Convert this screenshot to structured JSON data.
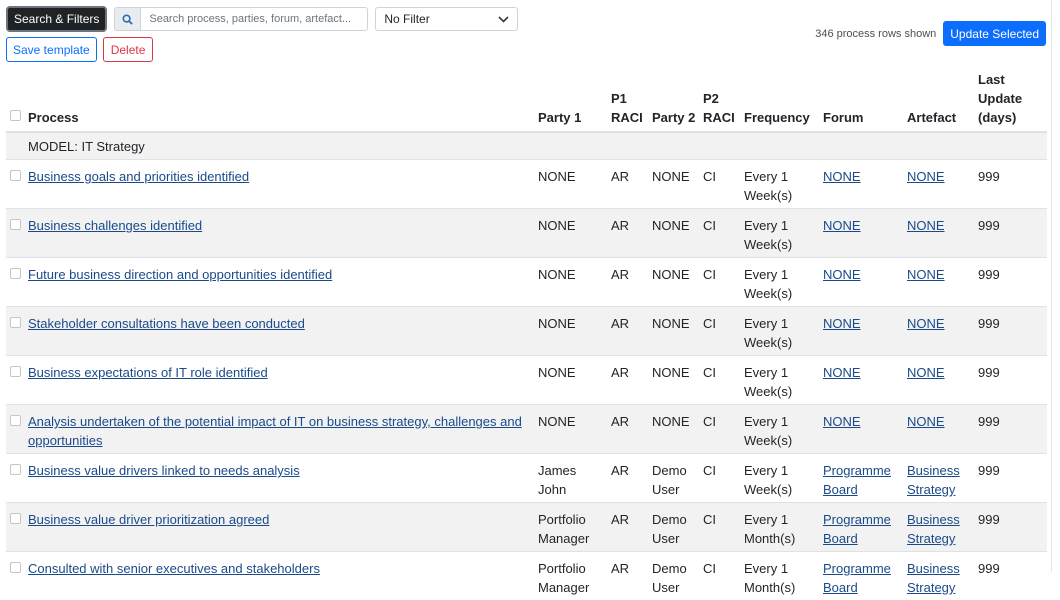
{
  "toolbar": {
    "search_filters_label": "Search & Filters",
    "search_placeholder": "Search process, parties, forum, artefact...",
    "filter_value": "No Filter",
    "save_template_label": "Save template",
    "delete_label": "Delete",
    "rows_shown": "346 process rows shown",
    "update_selected_label": "Update Selected"
  },
  "table": {
    "headers": {
      "process": "Process",
      "party1": "Party 1",
      "p1raci_a": "P1",
      "p1raci_b": "RACI",
      "party2": "Party 2",
      "p2raci_a": "P2",
      "p2raci_b": "RACI",
      "frequency": "Frequency",
      "forum": "Forum",
      "artefact": "Artefact",
      "last_a": "Last",
      "last_b": "Update",
      "last_c": "(days)"
    },
    "model_label": "MODEL: IT Strategy",
    "rows": [
      {
        "process": "Business goals and priorities identified",
        "party1": "NONE",
        "p1raci": "AR",
        "party2": "NONE",
        "p2raci": "CI",
        "freq1": "Every 1",
        "freq2": "Week(s)",
        "forum1": "NONE",
        "forum2": "",
        "artefact1": "NONE",
        "artefact2": "",
        "last": "999"
      },
      {
        "process": "Business challenges identified",
        "party1": "NONE",
        "p1raci": "AR",
        "party2": "NONE",
        "p2raci": "CI",
        "freq1": "Every 1",
        "freq2": "Week(s)",
        "forum1": "NONE",
        "forum2": "",
        "artefact1": "NONE",
        "artefact2": "",
        "last": "999"
      },
      {
        "process": "Future business direction and opportunities identified",
        "party1": "NONE",
        "p1raci": "AR",
        "party2": "NONE",
        "p2raci": "CI",
        "freq1": "Every 1",
        "freq2": "Week(s)",
        "forum1": "NONE",
        "forum2": "",
        "artefact1": "NONE",
        "artefact2": "",
        "last": "999"
      },
      {
        "process": "Stakeholder consultations have been conducted",
        "party1": "NONE",
        "p1raci": "AR",
        "party2": "NONE",
        "p2raci": "CI",
        "freq1": "Every 1",
        "freq2": "Week(s)",
        "forum1": "NONE",
        "forum2": "",
        "artefact1": "NONE",
        "artefact2": "",
        "last": "999"
      },
      {
        "process": "Business expectations of IT role identified",
        "party1": "NONE",
        "p1raci": "AR",
        "party2": "NONE",
        "p2raci": "CI",
        "freq1": "Every 1",
        "freq2": "Week(s)",
        "forum1": "NONE",
        "forum2": "",
        "artefact1": "NONE",
        "artefact2": "",
        "last": "999"
      },
      {
        "process": "Analysis undertaken of the potential impact of IT on business strategy, challenges and opportunities",
        "party1": "NONE",
        "p1raci": "AR",
        "party2": "NONE",
        "p2raci": "CI",
        "freq1": "Every 1",
        "freq2": "Week(s)",
        "forum1": "NONE",
        "forum2": "",
        "artefact1": "NONE",
        "artefact2": "",
        "last": "999"
      },
      {
        "process": "Business value drivers linked to needs analysis",
        "party1": "James John",
        "p1raci": "AR",
        "party2": "Demo User",
        "p2raci": "CI",
        "freq1": "Every 1",
        "freq2": "Week(s)",
        "forum1": "Programme",
        "forum2": "Board",
        "artefact1": "Business",
        "artefact2": "Strategy",
        "last": "999"
      },
      {
        "process": "Business value driver prioritization agreed",
        "party1": "Portfolio Manager",
        "p1raci": "AR",
        "party2": "Demo User",
        "p2raci": "CI",
        "freq1": "Every 1",
        "freq2": "Month(s)",
        "forum1": "Programme",
        "forum2": "Board",
        "artefact1": "Business",
        "artefact2": "Strategy",
        "last": "999"
      },
      {
        "process": "Consulted with senior executives and stakeholders",
        "party1": "Portfolio Manager",
        "p1raci": "AR",
        "party2": "Demo User",
        "p2raci": "CI",
        "freq1": "Every 1",
        "freq2": "Month(s)",
        "forum1": "Programme",
        "forum2": "Board",
        "artefact1": "Business",
        "artefact2": "Strategy",
        "last": "999"
      }
    ]
  }
}
